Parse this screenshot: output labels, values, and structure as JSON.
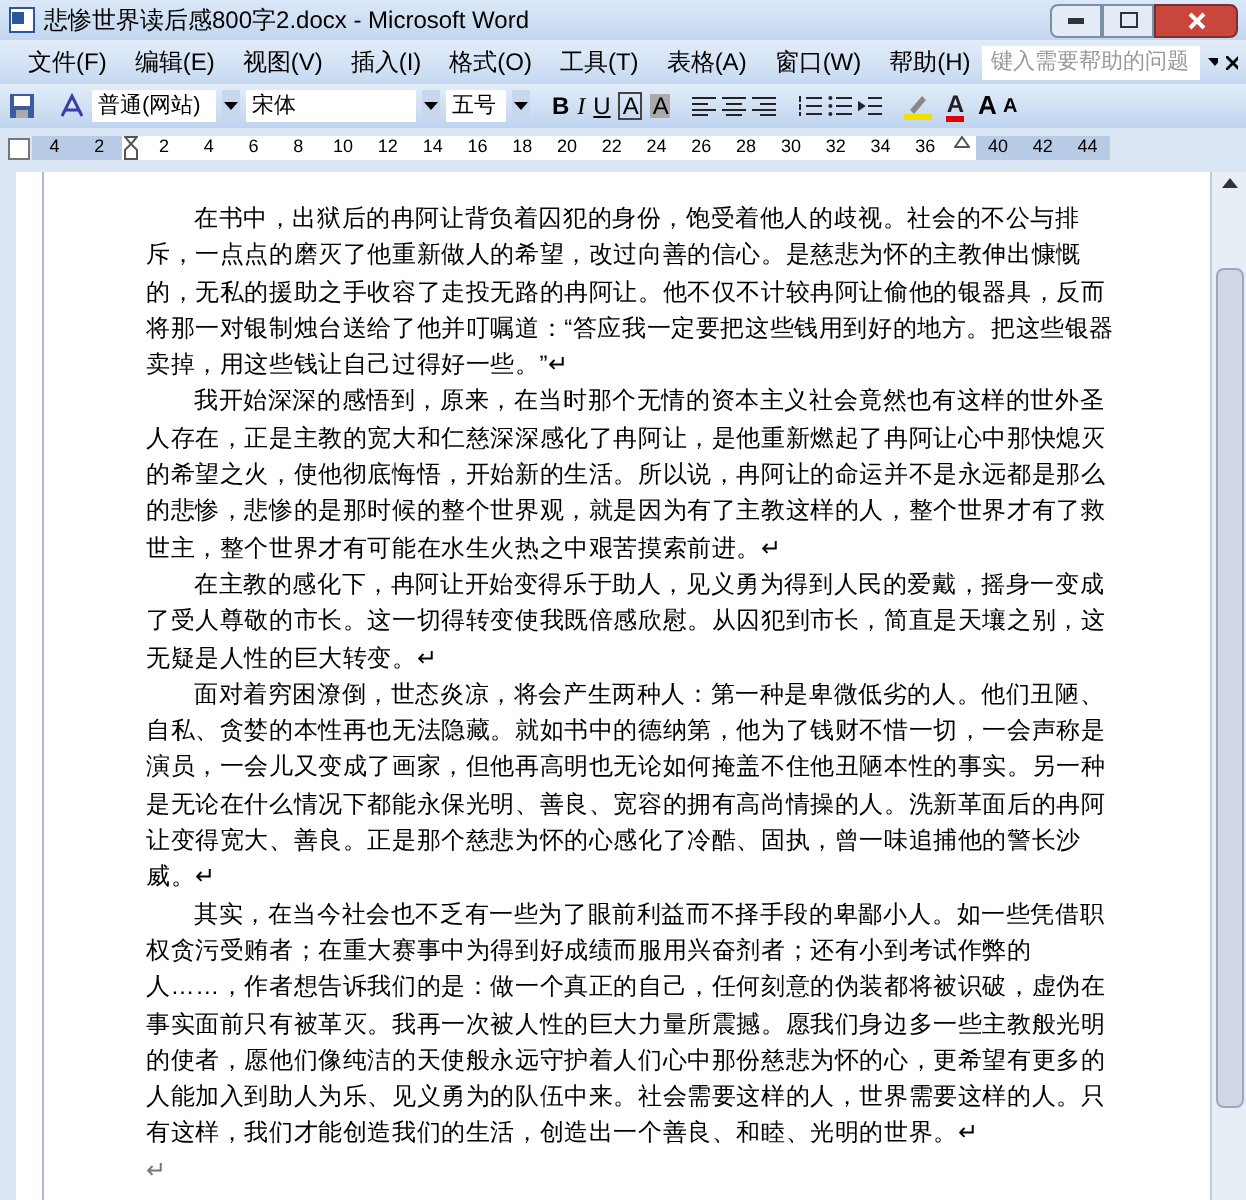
{
  "window": {
    "title": "悲惨世界读后感800字2.docx - Microsoft Word"
  },
  "menu": [
    {
      "label": "文件(F)"
    },
    {
      "label": "编辑(E)"
    },
    {
      "label": "视图(V)"
    },
    {
      "label": "插入(I)"
    },
    {
      "label": "格式(O)"
    },
    {
      "label": "工具(T)"
    },
    {
      "label": "表格(A)"
    },
    {
      "label": "窗口(W)"
    },
    {
      "label": "帮助(H)"
    }
  ],
  "help_search": {
    "placeholder": "键入需要帮助的问题"
  },
  "toolbar": {
    "style": "普通(网站)",
    "font": "宋体",
    "size": "五号",
    "format_buttons": [
      "B",
      "I",
      "U",
      "A",
      "A"
    ],
    "font_color": "A",
    "grow": "A",
    "shrink": "A"
  },
  "ruler": {
    "left_numbers": [
      "4",
      "2"
    ],
    "body_numbers": [
      "2",
      "4",
      "6",
      "8",
      "10",
      "12",
      "14",
      "16",
      "18",
      "20",
      "22",
      "24",
      "26",
      "28",
      "30",
      "32",
      "34",
      "36"
    ],
    "right_numbers": [
      "40",
      "42",
      "44"
    ]
  },
  "document": {
    "paragraphs": [
      {
        "lines": [
          "在书中，出狱后的冉阿让背负着囚犯的身份，饱受着他人的歧视。社会的不公与排",
          "斥，一点点的磨灭了他重新做人的希望，改过向善的信心。是慈悲为怀的主教伸出慷慨",
          "的，无私的援助之手收容了走投无路的冉阿让。他不仅不计较冉阿让偷他的银器具，反而",
          "将那一对银制烛台送给了他并叮嘱道：“答应我一定要把这些钱用到好的地方。把这些银器",
          "卖掉，用这些钱让自己过得好一些。”↵"
        ]
      },
      {
        "lines": [
          "我开始深深的感悟到，原来，在当时那个无情的资本主义社会竟然也有这样的世外圣",
          "人存在，正是主教的宽大和仁慈深深感化了冉阿让，是他重新燃起了冉阿让心中那快熄灭",
          "的希望之火，使他彻底悔悟，开始新的生活。所以说，冉阿让的命运并不是永远都是那么",
          "的悲惨，悲惨的是那时候的整个世界观，就是因为有了主教这样的人，整个世界才有了救",
          "世主，整个世界才有可能在水生火热之中艰苦摸索前进。↵"
        ]
      },
      {
        "lines": [
          "在主教的感化下，冉阿让开始变得乐于助人，见义勇为得到人民的爱戴，摇身一变成",
          "了受人尊敬的市长。这一切得转变使我既倍感欣慰。从囚犯到市长，简直是天壤之别，这",
          "无疑是人性的巨大转变。↵"
        ]
      },
      {
        "lines": [
          "面对着穷困潦倒，世态炎凉，将会产生两种人：第一种是卑微低劣的人。他们丑陋、",
          "自私、贪婪的本性再也无法隐藏。就如书中的德纳第，他为了钱财不惜一切，一会声称是",
          "演员，一会儿又变成了画家，但他再高明也无论如何掩盖不住他丑陋本性的事实。另一种",
          "是无论在什么情况下都能永保光明、善良、宽容的拥有高尚情操的人。洗新革面后的冉阿",
          "让变得宽大、善良。正是那个慈悲为怀的心感化了冷酷、固执，曾一味追捕他的警长沙",
          "威。↵"
        ]
      },
      {
        "lines": [
          "其实，在当今社会也不乏有一些为了眼前利益而不择手段的卑鄙小人。如一些凭借职",
          "权贪污受贿者；在重大赛事中为得到好成绩而服用兴奋剂者；还有小到考试作弊的",
          "人……，作者想告诉我们的是：做一个真正的自己，任何刻意的伪装都将被识破，虚伪在",
          "事实面前只有被革灭。我再一次被人性的巨大力量所震撼。愿我们身边多一些主教般光明",
          "的使者，愿他们像纯洁的天使般永远守护着人们心中那份慈悲为怀的心，更希望有更多的",
          "人能加入到助人为乐、见义勇为的队伍中来。社会需要这样的人，世界需要这样的人。只",
          "有这样，我们才能创造我们的生活，创造出一个善良、和睦、光明的世界。↵"
        ]
      }
    ],
    "trailing_mark": "↵"
  }
}
